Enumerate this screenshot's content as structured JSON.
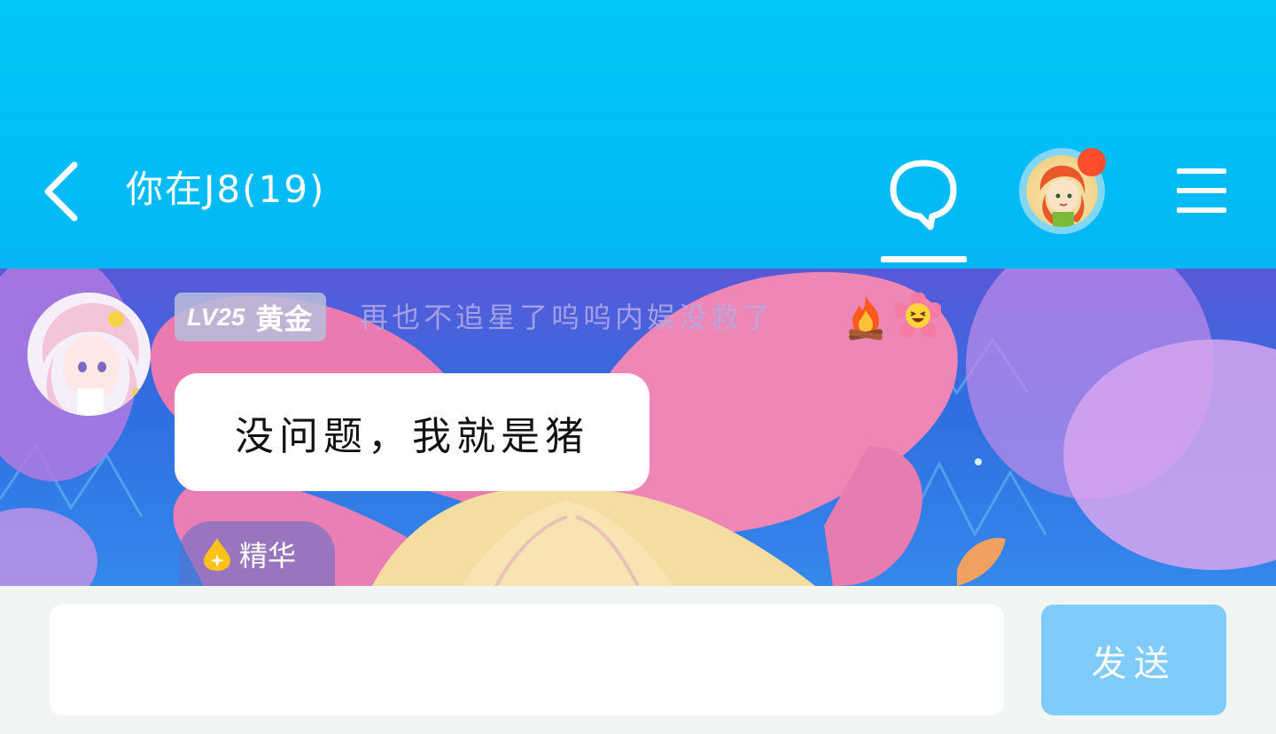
{
  "header": {
    "title": "你在J8(19)",
    "icons": {
      "back": "chevron-left-icon",
      "chat": "chat-bubble-icon",
      "menu": "hamburger-menu-icon"
    }
  },
  "message": {
    "level": "LV25",
    "rank": "黄金",
    "sender_title": "再也不追星了呜呜内娱没救了",
    "emojis": [
      "fire-emoji",
      "laughing-flower-emoji"
    ],
    "text": "没问题，我就是猪",
    "tag": "精华"
  },
  "input": {
    "placeholder": "",
    "value": ""
  },
  "send_label": "发送",
  "colors": {
    "header_bg": "#00c0f6",
    "send_button": "#7fcbfb",
    "notification_dot": "#ff4d2e",
    "input_bar_bg": "#f2f6f2"
  }
}
